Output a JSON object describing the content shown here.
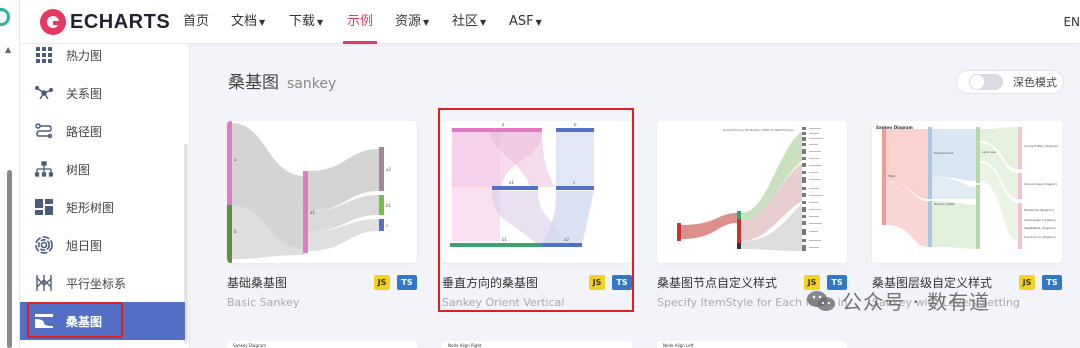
{
  "nav": {
    "logo_text": "ECHARTS",
    "items": [
      {
        "label": "首页",
        "caret": false
      },
      {
        "label": "文档",
        "caret": true
      },
      {
        "label": "下载",
        "caret": true
      },
      {
        "label": "示例",
        "caret": false,
        "active": true
      },
      {
        "label": "资源",
        "caret": true
      },
      {
        "label": "社区",
        "caret": true
      },
      {
        "label": "ASF",
        "caret": true
      }
    ],
    "lang": "EN"
  },
  "sidebar": {
    "items": [
      {
        "label": "热力图",
        "icon": "heatmap-icon"
      },
      {
        "label": "关系图",
        "icon": "graph-icon"
      },
      {
        "label": "路径图",
        "icon": "lines-icon"
      },
      {
        "label": "树图",
        "icon": "tree-icon"
      },
      {
        "label": "矩形树图",
        "icon": "treemap-icon"
      },
      {
        "label": "旭日图",
        "icon": "sunburst-icon"
      },
      {
        "label": "平行坐标系",
        "icon": "parallel-icon"
      },
      {
        "label": "桑基图",
        "icon": "sankey-icon",
        "active": true
      }
    ]
  },
  "main": {
    "title": "桑基图",
    "subtitle": "sankey",
    "dark_mode_label": "深色模式",
    "cards": [
      {
        "cn": "基础桑基图",
        "en": "Basic Sankey"
      },
      {
        "cn": "垂直方向的桑基图",
        "en": "Sankey Orient Vertical"
      },
      {
        "cn": "桑基图节点自定义样式",
        "en": "Specify ItemStyle for Each Node in Sankey"
      },
      {
        "cn": "桑基图层级自定义样式",
        "en": "Sankey with Levels Setting"
      }
    ],
    "badges": {
      "js": "JS",
      "ts": "TS"
    },
    "thumb_text": {
      "node_style_title": "Gross Primary Production (GPP) to Net Primary...",
      "levels_title": "Sankey Diagram",
      "levels_nodes": [
        "Total",
        "Environment",
        "Human rights",
        "Land use",
        "Cocoa butter (Organic)",
        "Cocoa mass (Organic)",
        "Hazelnuts (Organic)",
        "Cane sugar (Organic)",
        "Vegetables (Organic)",
        "Coconut oil (Organic)"
      ],
      "row2": [
        "Sankey Diagram",
        "Node Align Right",
        "Node Align Left"
      ]
    }
  },
  "watermark": "公众号 · 数有道",
  "colors": {
    "accent": "#e43961",
    "sidebar_active": "#5470c6",
    "highlight": "#e02020"
  }
}
